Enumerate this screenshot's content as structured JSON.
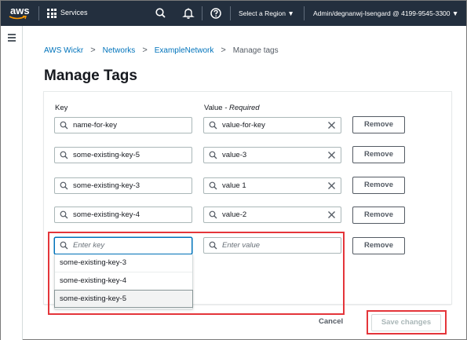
{
  "topnav": {
    "logo": "aws",
    "services_label": "Services",
    "region_label": "Select a Region ▼",
    "account_label": "Admin/degnanwj-Isengard @ 4199-9545-3300 ▼"
  },
  "breadcrumb": {
    "items": [
      "AWS Wickr",
      "Networks",
      "ExampleNetwork"
    ],
    "current": "Manage tags"
  },
  "page": {
    "title": "Manage Tags"
  },
  "columns": {
    "key_label": "Key",
    "value_label": "Value",
    "value_required": "- Required"
  },
  "tags": [
    {
      "key": "name-for-key",
      "value": "value-for-key",
      "remove_label": "Remove"
    },
    {
      "key": "some-existing-key-5",
      "value": "value-3",
      "remove_label": "Remove"
    },
    {
      "key": "some-existing-key-3",
      "value": "value 1",
      "remove_label": "Remove"
    },
    {
      "key": "some-existing-key-4",
      "value": "value-2",
      "remove_label": "Remove"
    }
  ],
  "new_tag": {
    "key_placeholder": "Enter key",
    "value_placeholder": "Enter value",
    "remove_label": "Remove"
  },
  "suggestions": [
    "some-existing-key-3",
    "some-existing-key-4",
    "some-existing-key-5"
  ],
  "actions": {
    "cancel_label": "Cancel",
    "save_label": "Save changes"
  },
  "colors": {
    "nav_bg": "#232f3e",
    "link": "#0073bb",
    "focus": "#0073bb",
    "highlight_box": "#e4353a"
  }
}
